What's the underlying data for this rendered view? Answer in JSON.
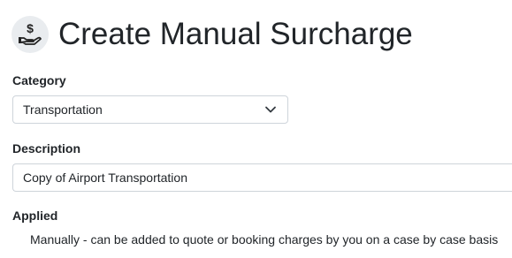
{
  "header": {
    "title": "Create Manual Surcharge",
    "icon": "hand-dollar-icon"
  },
  "category": {
    "label": "Category",
    "selected": "Transportation"
  },
  "description": {
    "label": "Description",
    "value": "Copy of Airport Transportation"
  },
  "applied": {
    "label": "Applied",
    "text": "Manually - can be added to quote or booking charges by you on a case by case basis"
  }
}
